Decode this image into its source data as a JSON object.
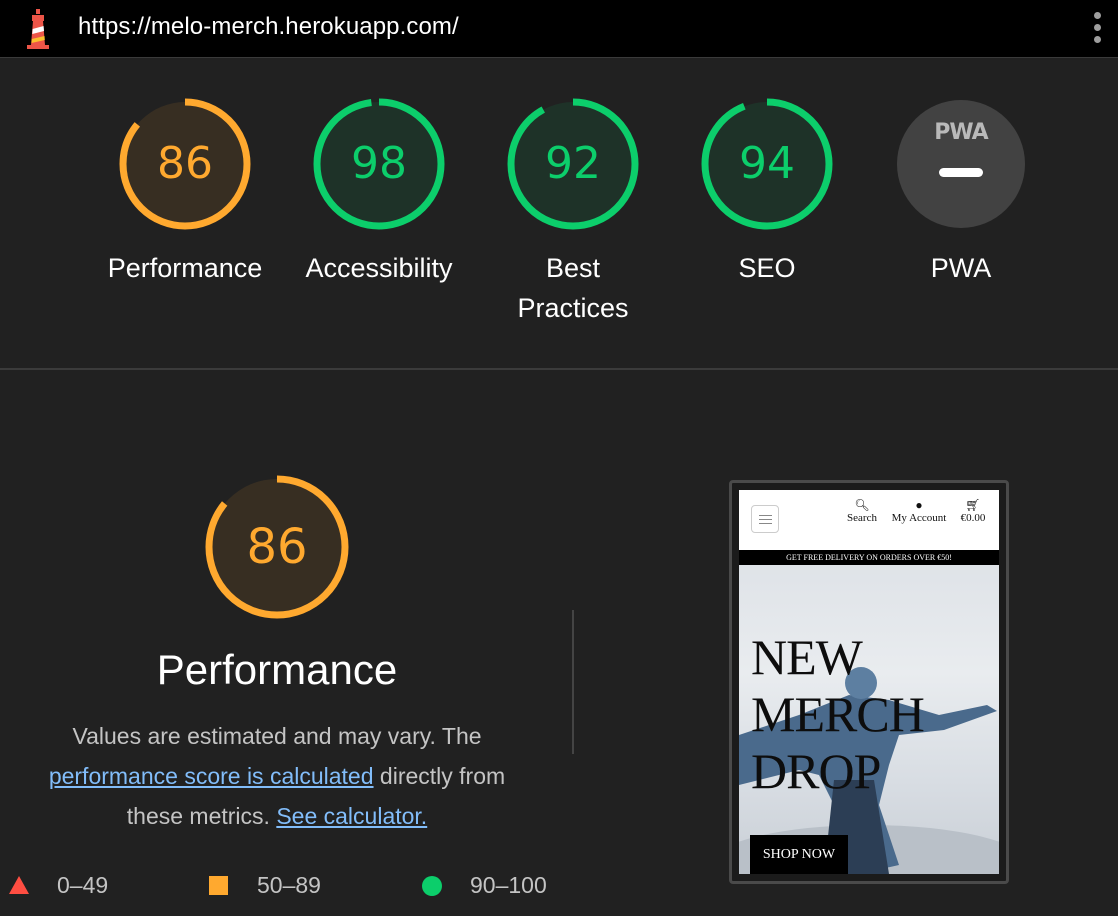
{
  "browser": {
    "url": "https://melo-merch.herokuapp.com/",
    "icons": [
      "lighthouse-logo-icon",
      "more-vert-icon"
    ]
  },
  "scores": [
    {
      "id": "performance",
      "value": "86",
      "label": "Performance",
      "status": "average"
    },
    {
      "id": "accessibility",
      "value": "98",
      "label": "Accessibility",
      "status": "pass"
    },
    {
      "id": "best-practices",
      "value": "92",
      "label": "Best Practices",
      "status": "pass"
    },
    {
      "id": "seo",
      "value": "94",
      "label": "SEO",
      "status": "pass"
    },
    {
      "id": "pwa",
      "badge": "PWA",
      "label": "PWA",
      "status": "n/a"
    }
  ],
  "performance_section": {
    "score": "86",
    "title": "Performance",
    "desc_1": "Values are estimated and may vary. The",
    "link_score": "performance score is calculated",
    "desc_2": "directly from these metrics.",
    "link_calculator": "See calculator."
  },
  "legend": [
    {
      "range": "0–49",
      "color": "#ff4e42",
      "shape": "triangle"
    },
    {
      "range": "50–89",
      "color": "#ffa92f",
      "shape": "square"
    },
    {
      "range": "90–100",
      "color": "#0cce6b",
      "shape": "circle"
    }
  ],
  "colors": {
    "average": "#ffa92f",
    "pass": "#0cce6b",
    "background": "#212121"
  },
  "screenshot": {
    "nav": [
      {
        "label": "Search",
        "icon": "search-icon"
      },
      {
        "label": "My Account",
        "icon": "account-icon"
      },
      {
        "label": "€0.00",
        "icon": "cart-icon"
      }
    ],
    "banner": "GET FREE DELIVERY ON ORDERS OVER €50!",
    "hero_line_1": "NEW",
    "hero_line_2": "MERCH",
    "hero_line_3": "DROP",
    "cta": "SHOP NOW"
  }
}
